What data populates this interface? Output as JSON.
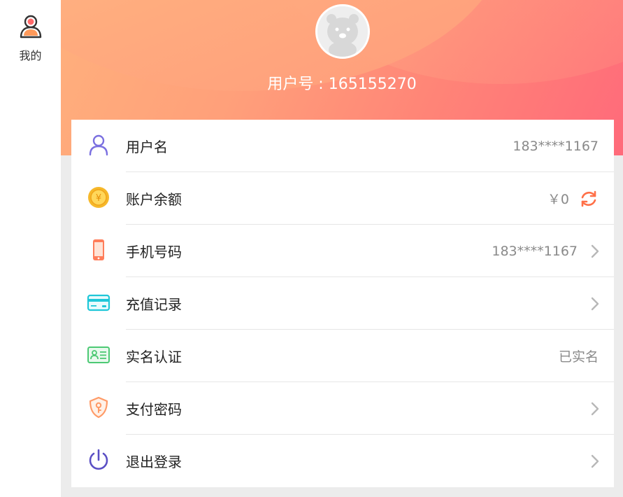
{
  "sidebar": {
    "tab_label": "我的",
    "tab_icon": "user-icon"
  },
  "header": {
    "user_no": "用户号 : 165155270",
    "avatar_icon": "bear-avatar-icon"
  },
  "menu": [
    {
      "title": "用户名",
      "value": "183****1167",
      "icon": "user-icon",
      "arrow": false
    },
    {
      "title": "账户余额",
      "value": "￥0",
      "icon": "coin-icon",
      "arrow": false,
      "refresh": true
    },
    {
      "title": "手机号码",
      "value": "183****1167",
      "icon": "phone-icon",
      "arrow": true
    },
    {
      "title": "充值记录",
      "value": "",
      "icon": "card-icon",
      "arrow": true
    },
    {
      "title": "实名认证",
      "value": "已实名",
      "icon": "id-card-icon",
      "arrow": false
    },
    {
      "title": "支付密码",
      "value": "",
      "icon": "shield-key-icon",
      "arrow": true
    },
    {
      "title": "退出登录",
      "value": "",
      "icon": "power-icon",
      "arrow": true
    }
  ],
  "colors": {
    "accent": "#ff7f50",
    "banner_start": "#ffb07c",
    "banner_end": "#ff6a7a"
  }
}
